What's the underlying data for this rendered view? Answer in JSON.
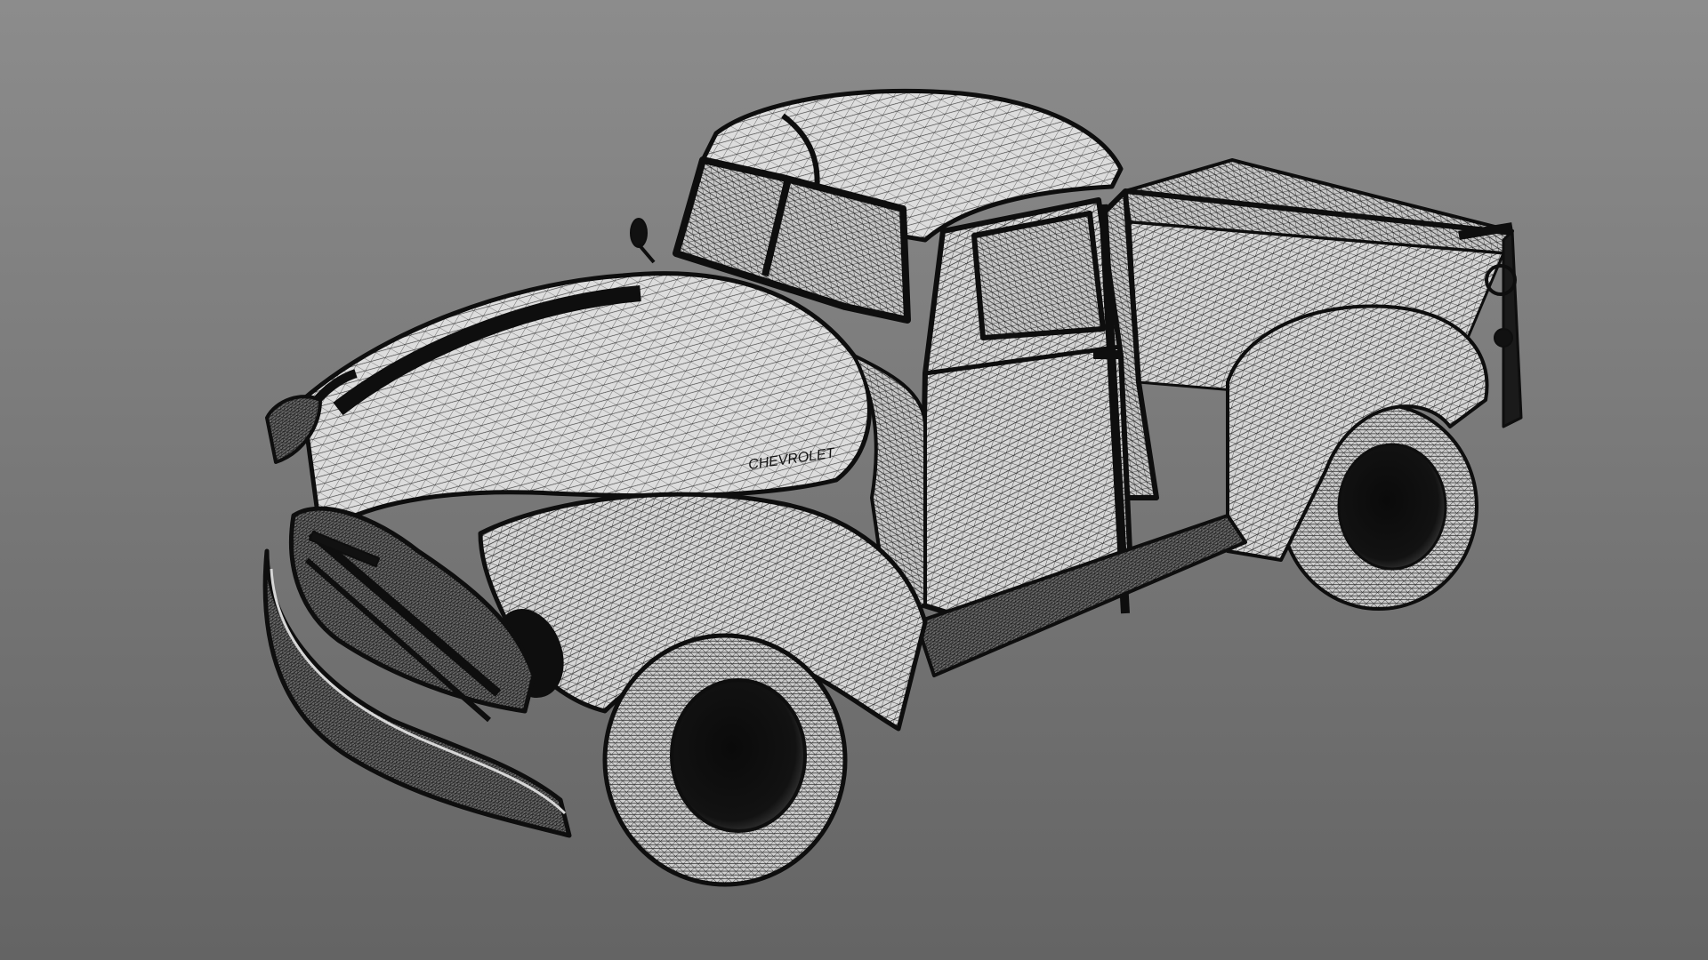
{
  "scene": {
    "subject": "pickup-truck-wireframe",
    "render_mode": "wireframe-mesh",
    "emblem_text": "CHEVROLET",
    "colors": {
      "background_top": "#8c8c8c",
      "background_bottom": "#646464",
      "mesh_fill": "#d4d4d4",
      "mesh_line": "#1a1a1a",
      "dark_shade": "#0e0e0e",
      "highlight": "#eeeeee"
    }
  }
}
